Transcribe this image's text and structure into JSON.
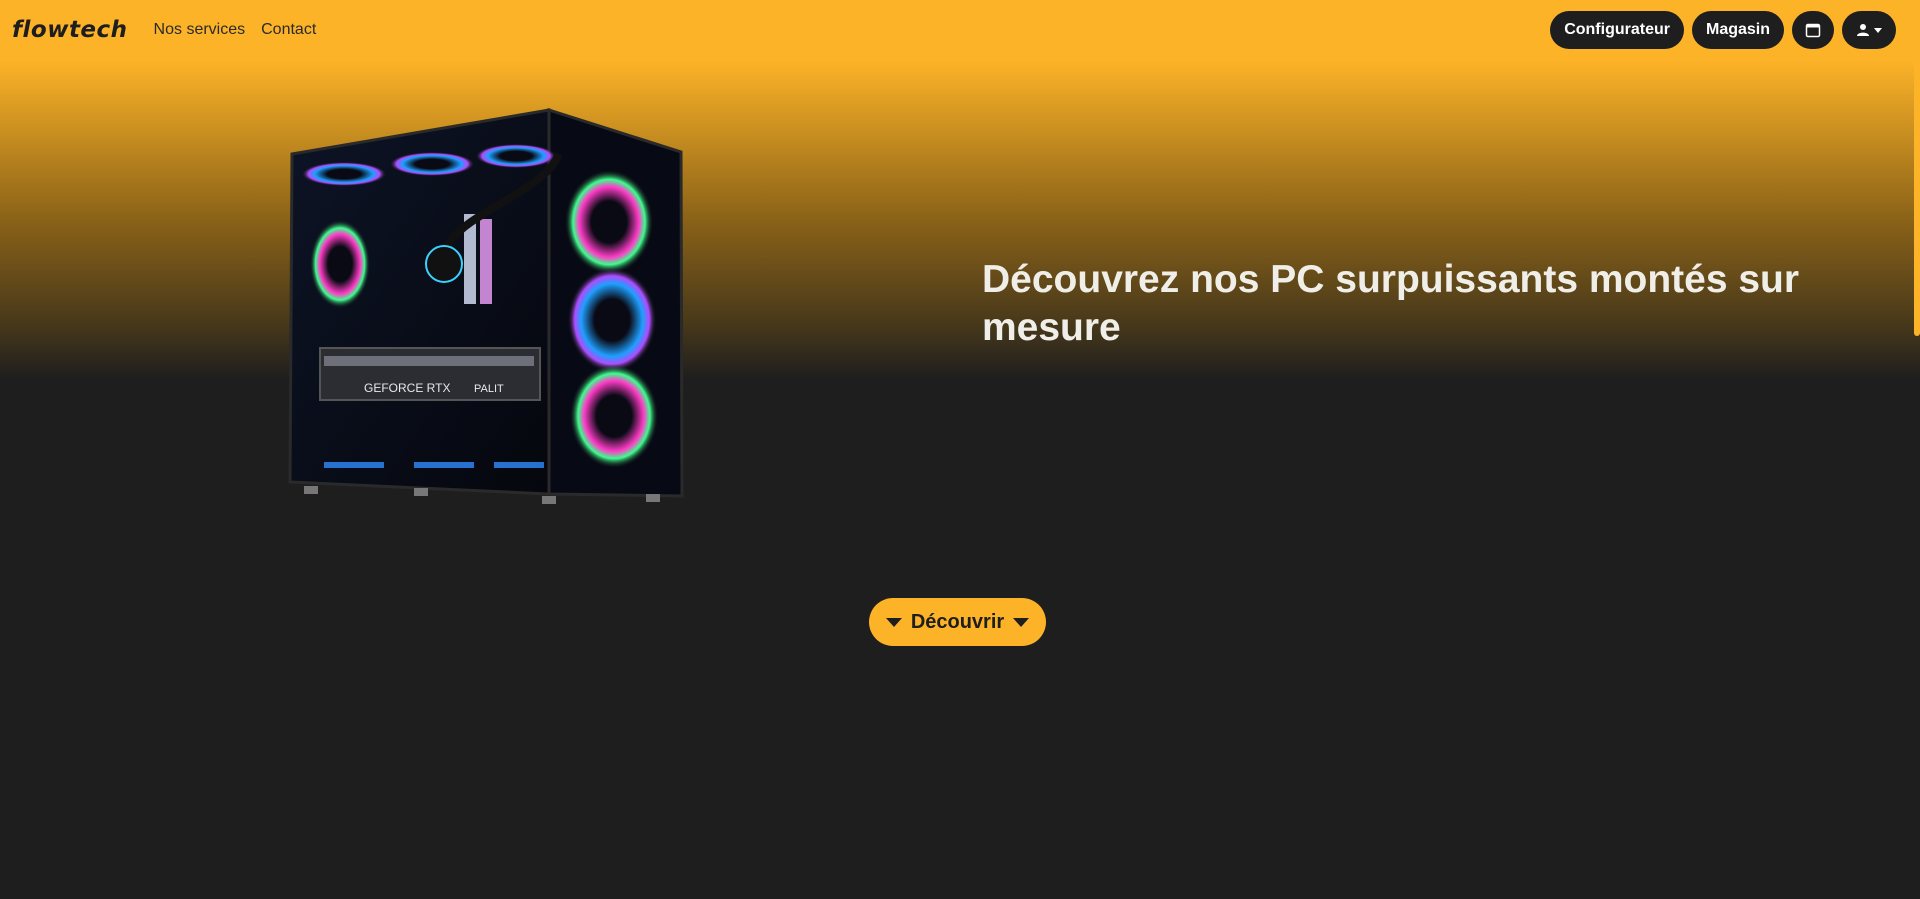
{
  "navbar": {
    "brand": "flowtech",
    "links": [
      "Nos services",
      "Contact"
    ],
    "configurator_label": "Configurateur",
    "store_label": "Magasin",
    "calendar_icon": "calendar-icon",
    "user_icon": "user-icon"
  },
  "hero": {
    "headline": "Découvrez nos PC surpuissants montés sur mesure",
    "cta_label": "Découvrir",
    "image_alt": "PC gamer avec ventilateurs RGB et carte graphique GeForce RTX",
    "gpu_text": "GEFORCE RTX",
    "gpu_brand": "PALIT"
  },
  "colors": {
    "accent": "#fdb328",
    "dark": "#1e1e1e",
    "headline_text": "#f0eee8"
  }
}
